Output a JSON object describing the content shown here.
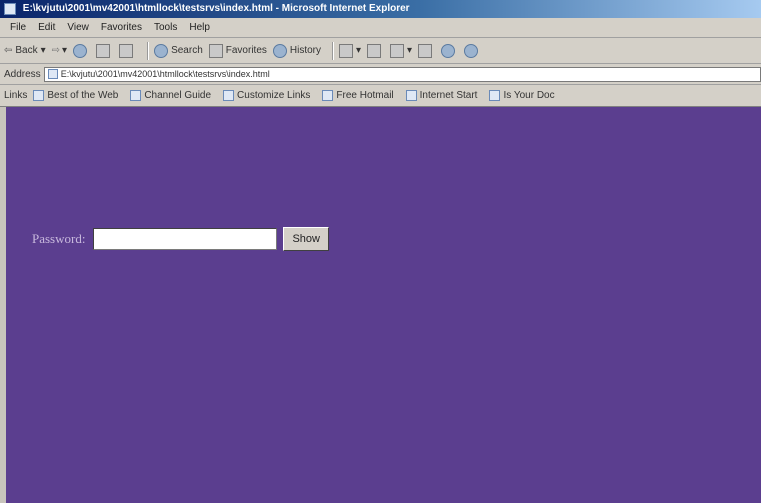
{
  "window": {
    "title": "E:\\kvjutu\\2001\\mv42001\\htmllock\\testsrvs\\index.html - Microsoft Internet Explorer"
  },
  "menubar": {
    "items": [
      "File",
      "Edit",
      "View",
      "Favorites",
      "Tools",
      "Help"
    ]
  },
  "toolbar": {
    "back": "Back",
    "search": "Search",
    "favorites": "Favorites",
    "history": "History"
  },
  "addressbar": {
    "label": "Address",
    "url": "E:\\kvjutu\\2001\\mv42001\\htmllock\\testsrvs\\index.html"
  },
  "linksbar": {
    "label": "Links",
    "items": [
      "Best of the Web",
      "Channel Guide",
      "Customize Links",
      "Free Hotmail",
      "Internet Start",
      "Is Your Doc"
    ]
  },
  "page": {
    "background": "#5b3e8f",
    "password_label": "Password:",
    "password_value": "",
    "show_button": "Show"
  }
}
